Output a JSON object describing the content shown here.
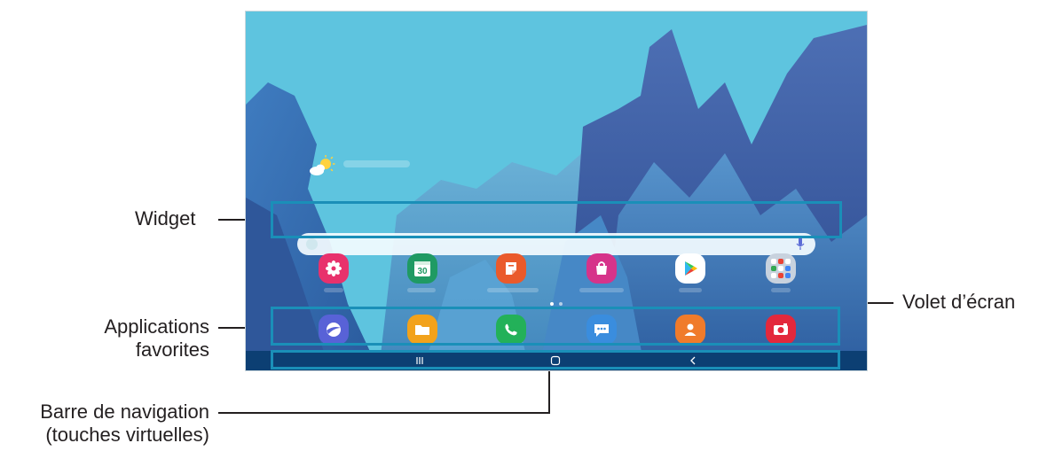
{
  "callouts": {
    "widget": "Widget",
    "favorite_apps_line1": "Applications",
    "favorite_apps_line2": "favorites",
    "nav_bar_line1": "Barre de navigation",
    "nav_bar_line2": "(touches virtuelles)",
    "screen_panel": "Volet d’écran"
  },
  "colors": {
    "accent_box": "#1a8fb8",
    "nav_bar": "#0c3f73",
    "sky": "#5ec4df"
  },
  "home_screen": {
    "weather_widget_icon": "weather-sun-cloud-icon",
    "search_widget_mic_icon": "microphone-icon",
    "apps_row": [
      {
        "icon": "gallery-icon",
        "color": "#e8316c"
      },
      {
        "icon": "calendar-icon",
        "color": "#1f9a63",
        "day": "30"
      },
      {
        "icon": "samsung-notes-icon",
        "color": "#ea5a2b"
      },
      {
        "icon": "galaxy-store-icon",
        "color": "#d6338a"
      },
      {
        "icon": "play-store-icon",
        "color": "#ffffff"
      },
      {
        "icon": "google-folder-icon",
        "color": "#c8d2de"
      }
    ],
    "favorites": [
      {
        "icon": "internet-browser-icon",
        "color": "#5862d7"
      },
      {
        "icon": "my-files-icon",
        "color": "#f2a21b"
      },
      {
        "icon": "phone-icon",
        "color": "#23b159"
      },
      {
        "icon": "messages-icon",
        "color": "#3a8dde"
      },
      {
        "icon": "contacts-icon",
        "color": "#f07b2b"
      },
      {
        "icon": "camera-icon",
        "color": "#e3283c"
      }
    ],
    "nav_buttons": [
      "recents-icon",
      "home-icon",
      "back-icon"
    ]
  }
}
